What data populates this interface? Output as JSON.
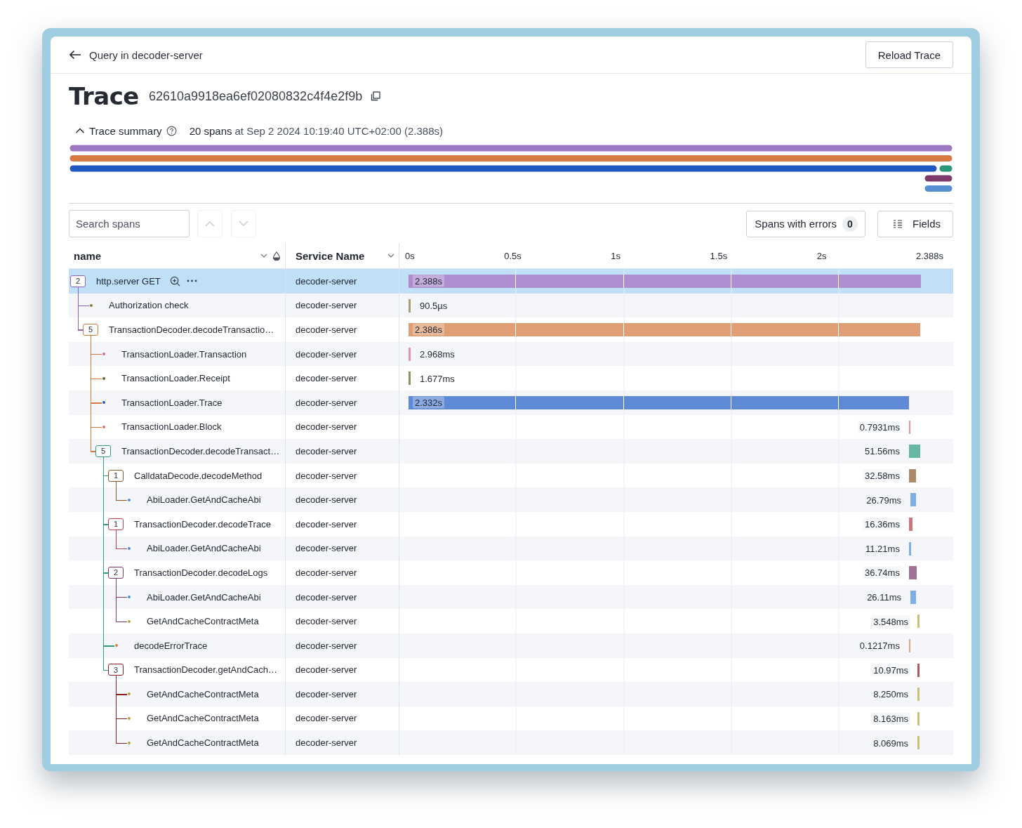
{
  "header": {
    "back_label": "Query in decoder-server",
    "reload_button": "Reload Trace"
  },
  "trace": {
    "title": "Trace",
    "id": "62610a9918ea6ef02080832c4f4e2f9b"
  },
  "summary": {
    "toggle_label": "Trace summary",
    "expanded": true,
    "span_count": "20 spans",
    "started": "at Sep 2 2024 10:19:40 UTC+02:00 (2.388s)"
  },
  "toolbar": {
    "search_placeholder": "Search spans",
    "nav_disabled": true,
    "errors_button": "Spans with errors",
    "errors_count": "0",
    "fields_button": "Fields"
  },
  "columns": [
    "name",
    "Service Name"
  ],
  "ticks": [
    "0s",
    "0.5s",
    "1s",
    "1.5s",
    "2s",
    "2.388s"
  ],
  "spans": [
    {
      "name": "http.server GET",
      "service": "decoder-server",
      "duration": "2.388s",
      "color": "#8e62bd",
      "level": 1.0,
      "kind": "early",
      "selected": true,
      "child_count": "2",
      "children": [
        {
          "name": "Authorization check",
          "service": "decoder-server",
          "duration": "90.5µs",
          "color": "#857a3a",
          "level": 4e-05,
          "kind": "early",
          "selected": false
        },
        {
          "name": "TransactionDecoder.decodeTransactio…",
          "service": "decoder-server",
          "duration": "2.386s",
          "color": "#d4783f",
          "level": 0.9992,
          "kind": "early",
          "selected": false,
          "child_count": "5",
          "children": [
            {
              "name": "TransactionLoader.Transaction",
              "service": "decoder-server",
              "duration": "2.968ms",
              "color": "#d96b8e",
              "level": 0.00124,
              "kind": "early",
              "selected": false
            },
            {
              "name": "TransactionLoader.Receipt",
              "service": "decoder-server",
              "duration": "1.677ms",
              "color": "#5b6b2a",
              "level": 0.0007,
              "kind": "early",
              "selected": false
            },
            {
              "name": "TransactionLoader.Trace",
              "service": "decoder-server",
              "duration": "2.332s",
              "color": "#1f5bc4",
              "level": 0.9766,
              "kind": "early",
              "selected": false
            },
            {
              "name": "TransactionLoader.Block",
              "service": "decoder-server",
              "duration": "0.7931ms",
              "color": "#e06c6c",
              "level": 0.00033,
              "kind": "late",
              "selected": false
            },
            {
              "name": "TransactionDecoder.decodeTransact…",
              "service": "decoder-server",
              "duration": "51.56ms",
              "color": "#2a9d82",
              "level": 0.0216,
              "kind": "late",
              "selected": false,
              "child_count": "5",
              "children": [
                {
                  "name": "CalldataDecode.decodeMethod",
                  "service": "decoder-server",
                  "duration": "32.58ms",
                  "color": "#8b5a2b",
                  "level": 0.0136,
                  "kind": "late",
                  "selected": false,
                  "child_count": "1",
                  "children": [
                    {
                      "name": "AbiLoader.GetAndCacheAbi",
                      "service": "decoder-server",
                      "duration": "26.79ms",
                      "color": "#4a90d9",
                      "level": 0.0112,
                      "kind": "mid",
                      "selected": false
                    }
                  ]
                },
                {
                  "name": "TransactionDecoder.decodeTrace",
                  "service": "decoder-server",
                  "duration": "16.36ms",
                  "color": "#b5414a",
                  "level": 0.0069,
                  "kind": "late",
                  "selected": false,
                  "child_count": "1",
                  "children": [
                    {
                      "name": "AbiLoader.GetAndCacheAbi",
                      "service": "decoder-server",
                      "duration": "11.21ms",
                      "color": "#4a90d9",
                      "level": 0.0047,
                      "kind": "late",
                      "selected": false
                    }
                  ]
                },
                {
                  "name": "TransactionDecoder.decodeLogs",
                  "service": "decoder-server",
                  "duration": "36.74ms",
                  "color": "#7d3a6b",
                  "level": 0.0154,
                  "kind": "late",
                  "selected": false,
                  "child_count": "2",
                  "children": [
                    {
                      "name": "AbiLoader.GetAndCacheAbi",
                      "service": "decoder-server",
                      "duration": "26.11ms",
                      "color": "#4a90d9",
                      "level": 0.0109,
                      "kind": "mid",
                      "selected": false
                    },
                    {
                      "name": "GetAndCacheContractMeta",
                      "service": "decoder-server",
                      "duration": "3.548ms",
                      "color": "#b5a642",
                      "level": 0.0015,
                      "kind": "tail",
                      "selected": false
                    }
                  ]
                },
                {
                  "name": "decodeErrorTrace",
                  "service": "decoder-server",
                  "duration": "0.1217ms",
                  "color": "#d9823f",
                  "level": 5e-05,
                  "kind": "late",
                  "selected": false
                },
                {
                  "name": "TransactionDecoder.getAndCach…",
                  "service": "decoder-server",
                  "duration": "10.97ms",
                  "color": "#8b1e1e",
                  "level": 0.0046,
                  "kind": "tail",
                  "selected": false,
                  "child_count": "3",
                  "children": [
                    {
                      "name": "GetAndCacheContractMeta",
                      "service": "decoder-server",
                      "duration": "8.250ms",
                      "color": "#b5a642",
                      "level": 0.0035,
                      "kind": "tail",
                      "selected": false
                    },
                    {
                      "name": "GetAndCacheContractMeta",
                      "service": "decoder-server",
                      "duration": "8.163ms",
                      "color": "#b5a642",
                      "level": 0.0034,
                      "kind": "tail",
                      "selected": false
                    },
                    {
                      "name": "GetAndCacheContractMeta",
                      "service": "decoder-server",
                      "duration": "8.069ms",
                      "color": "#b5a642",
                      "level": 0.0034,
                      "kind": "tail",
                      "selected": false
                    }
                  ]
                }
              ]
            }
          ]
        }
      ]
    }
  ]
}
